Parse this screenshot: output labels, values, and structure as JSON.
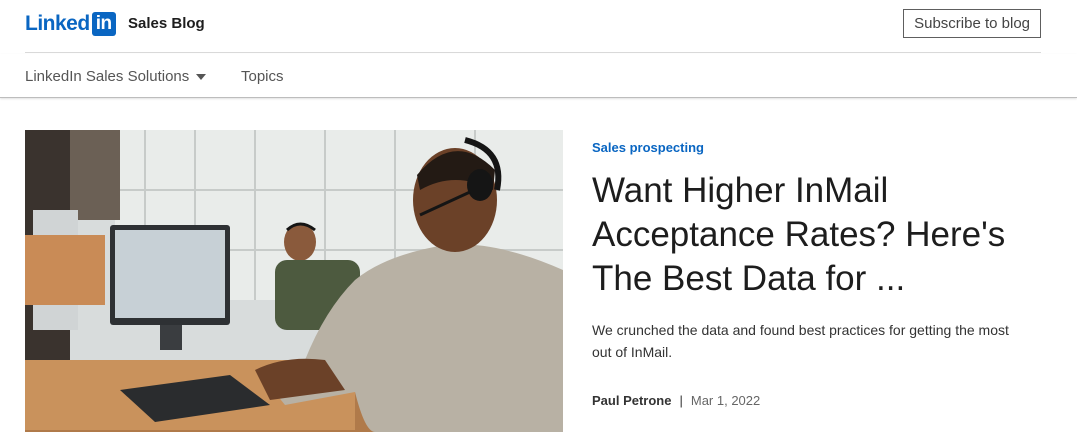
{
  "header": {
    "logo_word": "Linked",
    "logo_box": "in",
    "blog_name": "Sales Blog",
    "subscribe_label": "Subscribe to blog"
  },
  "nav": {
    "items": [
      {
        "label": "LinkedIn Sales Solutions",
        "has_dropdown": true
      },
      {
        "label": "Topics",
        "has_dropdown": false
      }
    ]
  },
  "article": {
    "category": "Sales prospecting",
    "title": "Want Higher InMail Acceptance Rates? Here's The Best Data for ...",
    "excerpt": "We crunched the data and found best practices for getting the most out of InMail.",
    "author": "Paul Petrone",
    "separator": "|",
    "date": "Mar 1, 2022",
    "image_icon": "office-photo"
  },
  "colors": {
    "brand_blue": "#0a66c2",
    "text": "#1d1d1d",
    "muted": "#666666"
  }
}
